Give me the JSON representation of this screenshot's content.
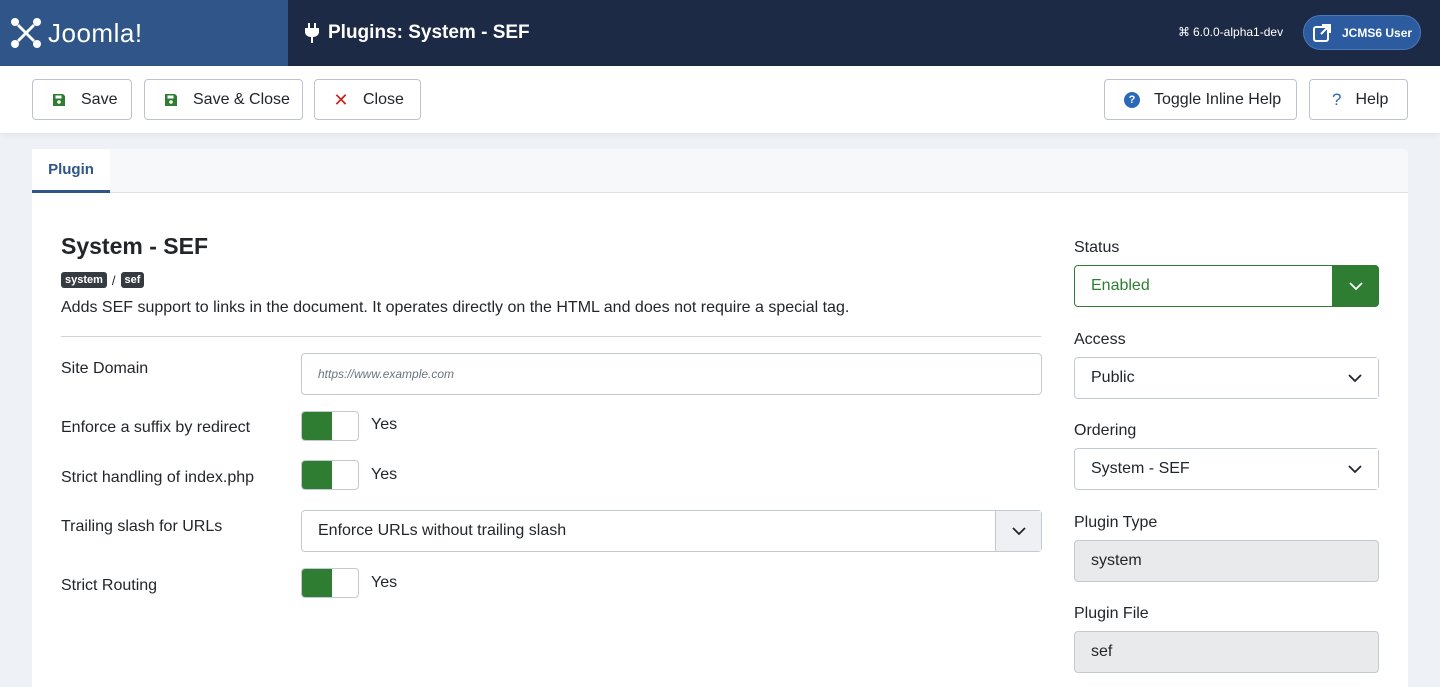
{
  "header": {
    "logo_text": "Joomla!",
    "page_title": "Plugins: System - SEF",
    "version": "6.0.0-alpha1-dev",
    "user_label": "JCMS6 User"
  },
  "toolbar": {
    "save_label": "Save",
    "save_close_label": "Save & Close",
    "close_label": "Close",
    "toggle_help_label": "Toggle Inline Help",
    "help_label": "Help"
  },
  "tabs": [
    {
      "label": "Plugin",
      "active": true
    }
  ],
  "plugin": {
    "name": "System - SEF",
    "folder_tag": "system",
    "element_tag": "sef",
    "description": "Adds SEF support to links in the document. It operates directly on the HTML and does not require a special tag."
  },
  "fields": {
    "site_domain": {
      "label": "Site Domain",
      "placeholder": "https://www.example.com",
      "value": ""
    },
    "enforce_suffix": {
      "label": "Enforce a suffix by redirect",
      "value": "Yes"
    },
    "strict_index": {
      "label": "Strict handling of index.php",
      "value": "Yes"
    },
    "trailing_slash": {
      "label": "Trailing slash for URLs",
      "value": "Enforce URLs without trailing slash"
    },
    "strict_routing": {
      "label": "Strict Routing",
      "value": "Yes"
    }
  },
  "sidebar": {
    "status": {
      "label": "Status",
      "value": "Enabled"
    },
    "access": {
      "label": "Access",
      "value": "Public"
    },
    "ordering": {
      "label": "Ordering",
      "value": "System - SEF"
    },
    "plugin_type": {
      "label": "Plugin Type",
      "value": "system"
    },
    "plugin_file": {
      "label": "Plugin File",
      "value": "sef"
    }
  },
  "colors": {
    "brand_dark": "#1c2a45",
    "brand_blue": "#2f5589",
    "success": "#2e7d32",
    "danger": "#c5221f",
    "info": "#2a69b8"
  },
  "icons": [
    "joomla-logo-icon",
    "plug-icon",
    "joomla-small-icon",
    "external-link-icon",
    "save-icon",
    "close-icon",
    "info-icon",
    "question-icon",
    "chevron-down-icon"
  ]
}
